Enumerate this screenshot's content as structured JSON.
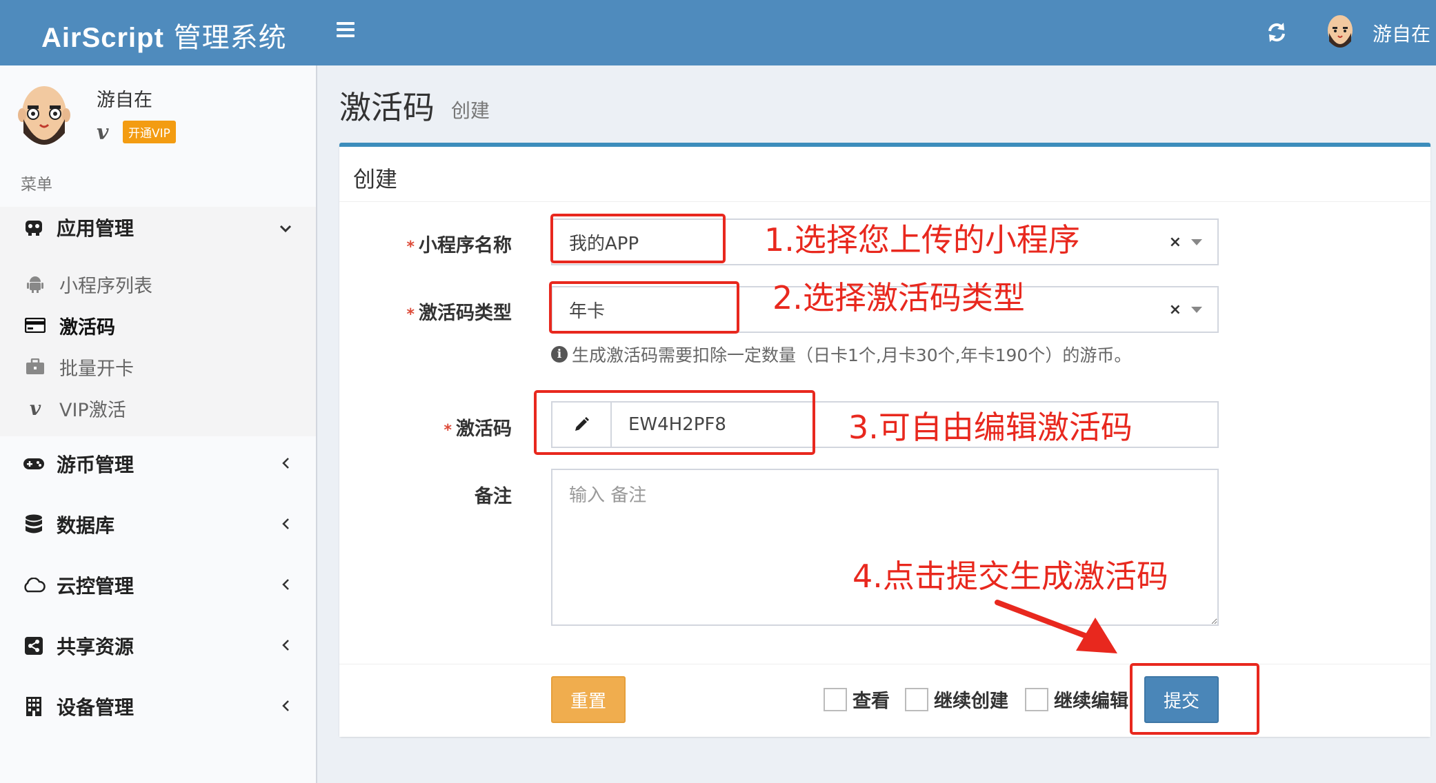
{
  "app": {
    "brand": "AirScript",
    "title_suffix": "管理系统"
  },
  "header": {
    "username": "游自在"
  },
  "sidebar": {
    "username": "游自在",
    "vip_badge": "开通VIP",
    "menu_header": "菜单",
    "groups": [
      {
        "label": "应用管理",
        "icon": "gamepad-app-icon",
        "expanded": true,
        "items": [
          {
            "label": "小程序列表",
            "icon": "android-icon"
          },
          {
            "label": "激活码",
            "icon": "credit-card-icon",
            "active": true
          },
          {
            "label": "批量开卡",
            "icon": "briefcase-icon"
          },
          {
            "label": "VIP激活",
            "icon": "vimeo-v-icon"
          }
        ]
      },
      {
        "label": "游币管理",
        "icon": "gamepad-icon"
      },
      {
        "label": "数据库",
        "icon": "database-icon"
      },
      {
        "label": "云控管理",
        "icon": "cloud-icon"
      },
      {
        "label": "共享资源",
        "icon": "share-icon"
      },
      {
        "label": "设备管理",
        "icon": "building-icon"
      }
    ]
  },
  "page": {
    "title": "激活码",
    "subtitle": "创建"
  },
  "form": {
    "box_title": "创建",
    "app_name": {
      "label": "小程序名称",
      "value": "我的APP"
    },
    "code_type": {
      "label": "激活码类型",
      "value": "年卡"
    },
    "hint": "生成激活码需要扣除一定数量（日卡1个,月卡30个,年卡190个）的游币。",
    "code": {
      "label": "激活码",
      "value": "EW4H2PF8"
    },
    "remark": {
      "label": "备注",
      "placeholder": "输入 备注"
    },
    "reset_label": "重置",
    "submit_label": "提交",
    "checkboxes": [
      "查看",
      "继续创建",
      "继续编辑"
    ]
  },
  "annotations": {
    "step1": "1.选择您上传的小程序",
    "step2": "2.选择激活码类型",
    "step3": "3.可自由编辑激活码",
    "step4": "4.点击提交生成激活码",
    "color": "#e8281e"
  },
  "colors": {
    "header": "#4f8bbd",
    "accent": "#3c8dbc",
    "warning": "#f0ad4e",
    "primary": "#4a86b8"
  }
}
